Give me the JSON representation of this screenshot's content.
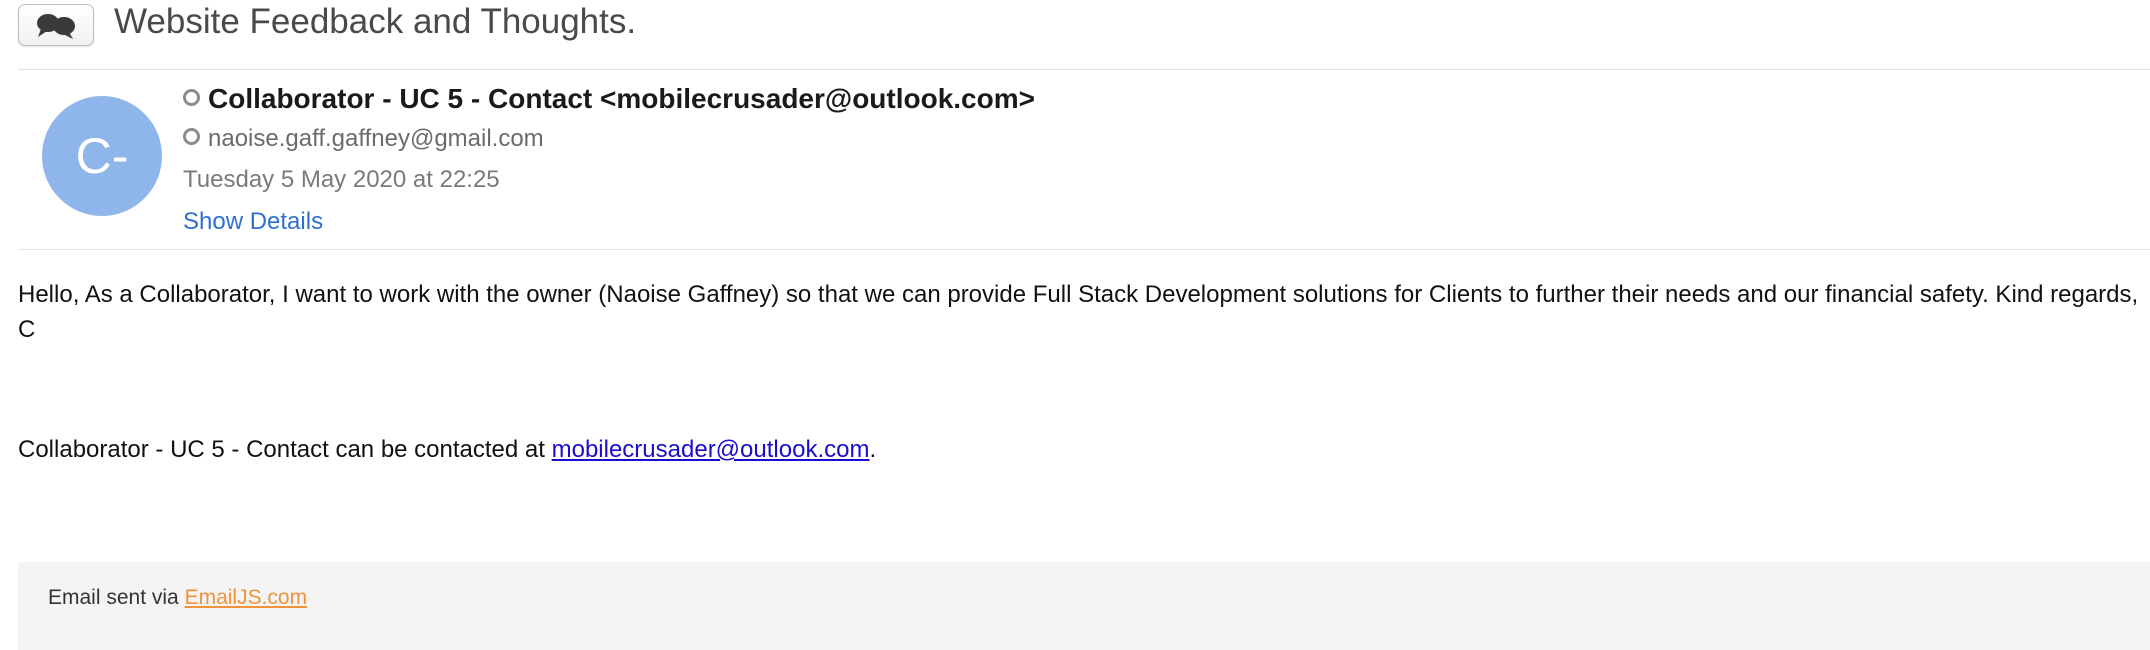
{
  "subject": {
    "icon": "speech-bubbles-icon",
    "title": "Website Feedback and Thoughts."
  },
  "header": {
    "avatar_initials": "C-",
    "avatar_color": "#8fb6ea",
    "from": "Collaborator - UC 5 - Contact <mobilecrusader@outlook.com>",
    "to": "naoise.gaff.gaffney@gmail.com",
    "date": "Tuesday 5 May 2020 at 22:25",
    "show_details_label": "Show Details"
  },
  "body": {
    "message": "Hello, As a Collaborator, I want to work with the owner (Naoise Gaffney) so that we can provide Full Stack Development solutions for Clients to further their needs and our financial safety. Kind regards, C",
    "contact_prefix": "Collaborator - UC 5 - Contact can be contacted at ",
    "contact_email": "mobilecrusader@outlook.com",
    "contact_suffix": "."
  },
  "footer": {
    "prefix": "Email sent via ",
    "link_label": "EmailJS.com",
    "link_color": "#f0923a"
  },
  "colors": {
    "link_blue": "#2e6fd1",
    "mail_link": "#1a0dcc"
  }
}
